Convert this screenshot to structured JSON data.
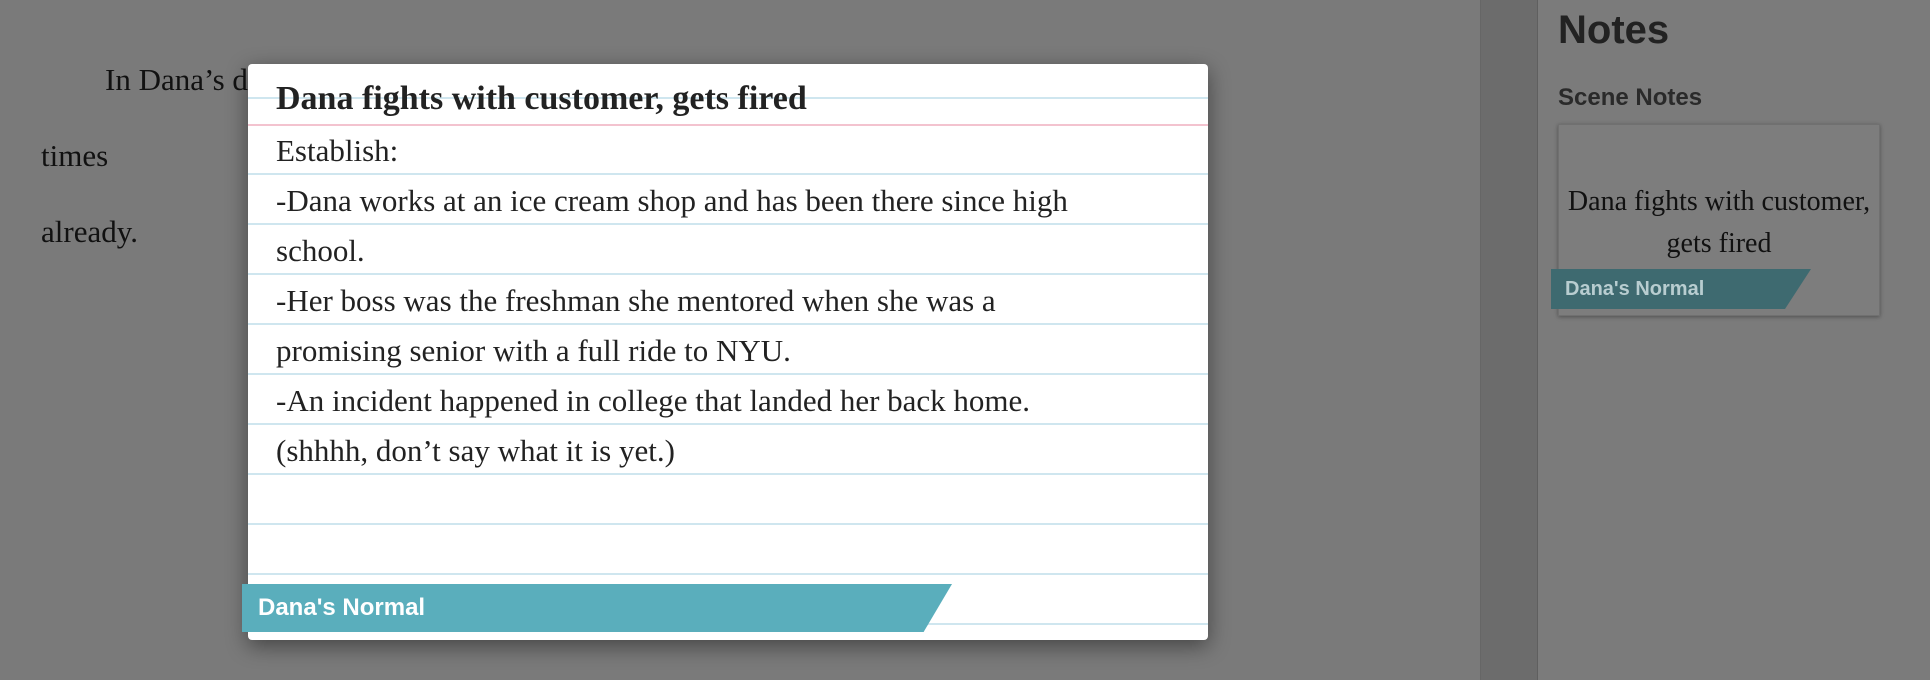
{
  "editor": {
    "line1_prefix": "In Dana’s d",
    "line1_suffix": "times",
    "line2": "already."
  },
  "notes_panel": {
    "title": "Notes",
    "section_label": "Scene Notes",
    "card": {
      "text": "Dana fights with customer, gets fired",
      "tag": "Dana's Normal"
    }
  },
  "modal_card": {
    "title": "Dana fights with customer, gets fired",
    "body_lines": [
      "Establish:",
      "-Dana works at an ice cream shop and has been there since high",
      "school.",
      "-Her boss was the freshman she mentored when she was a",
      "promising senior with a full ride to NYU.",
      "-An incident happened in college that landed her back home.",
      "(shhhh, don’t say what it is yet.)"
    ],
    "tag": "Dana's Normal"
  },
  "colors": {
    "overlay_gray": "#7a7a7a",
    "tag_teal": "#5aaebc",
    "tag_teal_dim": "#3e6a70",
    "ruled_line": "#cfe6ef",
    "margin_line": "#f3c3cf"
  }
}
